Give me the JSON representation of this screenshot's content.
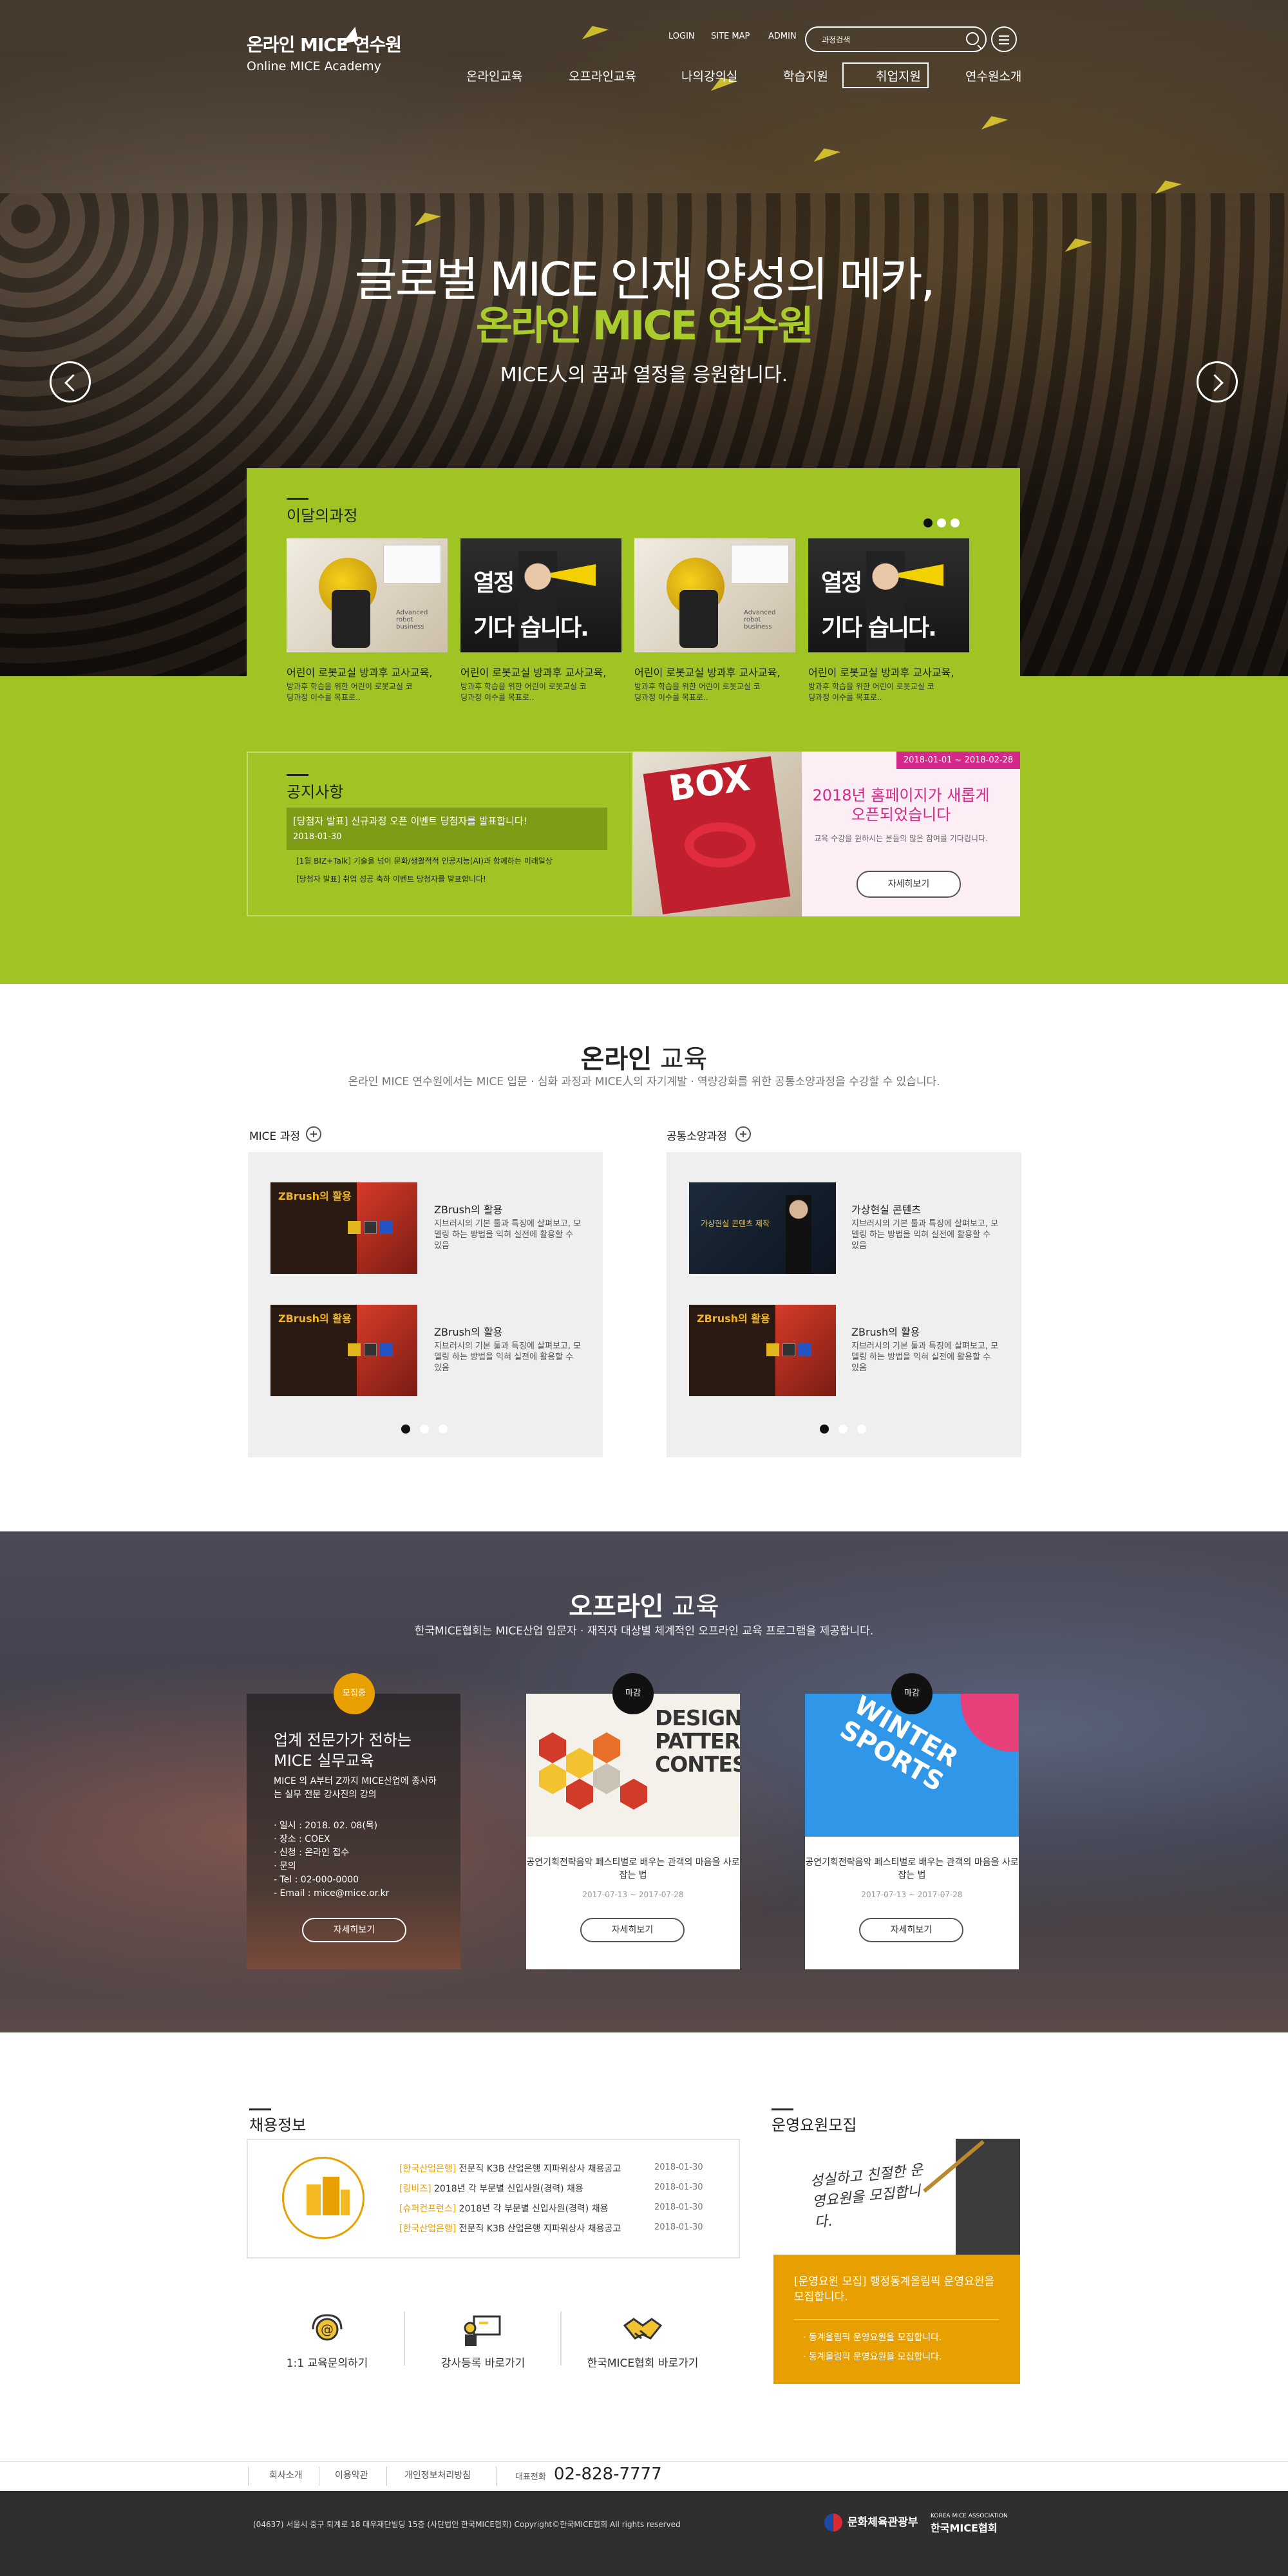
{
  "header": {
    "logo_ko": "온라인 MICE 연수원",
    "logo_en": "Online MICE Academy",
    "util_links": [
      "LOGIN",
      "SITE MAP",
      "ADMIN"
    ],
    "search_label": "과정검색",
    "nav": [
      "온라인교육",
      "오프라인교육",
      "나의강의실",
      "학습지원",
      "취업지원",
      "연수원소개"
    ]
  },
  "hero": {
    "title": "글로벌 MICE 인재 양성의 메카,",
    "subtitle": "온라인 MICE 연수원",
    "desc": "MICE人의 꿈과 열정을 응원합니다."
  },
  "monthly": {
    "title": "이달의과정",
    "cards": [
      {
        "title": "어린이 로봇교실 방과후 교사교육,",
        "desc": "방과후 학습을 위한 어린이 로봇교실 코딩과정 이수를 목표로..",
        "img_text": "Advanced robot business"
      },
      {
        "title": "어린이 로봇교실 방과후 교사교육,",
        "desc": "방과후 학습을 위한 어린이 로봇교실 코딩과정 이수를 목표로..",
        "img_top": "열정",
        "img_bottom": "기다    습니다."
      },
      {
        "title": "어린이 로봇교실 방과후 교사교육,",
        "desc": "방과후 학습을 위한 어린이 로봇교실 코딩과정 이수를 목표로..",
        "img_text": "Advanced robot business"
      },
      {
        "title": "어린이 로봇교실 방과후 교사교육,",
        "desc": "방과후 학습을 위한 어린이 로봇교실 코딩과정 이수를 목표로..",
        "img_top": "열정",
        "img_bottom": "기다    습니다."
      }
    ]
  },
  "notice": {
    "title": "공지사항",
    "highlight_title": "[당첨자 발표] 신규과정 오픈 이벤트 당첨자를 발표합니다!",
    "highlight_date": "2018-01-30",
    "items": [
      "[1월 BIZ+Talk] 기술을 넘어 문화/생활적적 인공지능(AI)과 함께하는 미래일상",
      "[당첨자 발표] 취업 성공 축하 이벤트 당첨자를 발표합니다!"
    ]
  },
  "event": {
    "box_text": "BOX",
    "date": "2018-01-01 ~ 2018-02-28",
    "title": "2018년 홈페이지가 새롭게 오픈되었습니다",
    "desc": "교육 수강을 원하시는 분들의 많은 참여를 기다립니다.",
    "button": "자세히보기"
  },
  "online": {
    "title_bold": "온라인",
    "title_rest": " 교육",
    "desc": "온라인 MICE 연수원에서는 MICE 입문 · 심화 과정과 MICE人의 자기계발 · 역량강화를 위한 공통소양과정을 수강할 수 있습니다.",
    "left_header": "MICE 과정",
    "right_header": "공통소양과정",
    "left_items": [
      {
        "title": "ZBrush의 활용",
        "desc": "지브러시의 기본 툴과 특징에 살펴보고, 모델링 하는 방법을 익혀 실전에 활용할 수 있음",
        "thumb": "ZBrush의 활용"
      },
      {
        "title": "ZBrush의 활용",
        "desc": "지브러시의 기본 툴과 특징에 살펴보고, 모델링 하는 방법을 익혀 실전에 활용할 수 있음",
        "thumb": "ZBrush의 활용"
      }
    ],
    "right_items": [
      {
        "title": "가상현실 콘텐츠",
        "desc": "지브러시의 기본 툴과 특징에 살펴보고, 모델링 하는 방법을 익혀 실전에 활용할 수 있음",
        "thumb": "가상현실 콘텐츠 제작"
      },
      {
        "title": "ZBrush의 활용",
        "desc": "지브러시의 기본 툴과 특징에 살펴보고, 모델링 하는 방법을 익혀 실전에 활용할 수 있음",
        "thumb": "ZBrush의 활용"
      }
    ]
  },
  "offline": {
    "title_bold": "오프라인",
    "title_rest": " 교육",
    "desc": "한국MICE협회는 MICE산업 입문자 · 재직자 대상별 체계적인 오프라인 교육 프로그램을 제공합니다.",
    "card1": {
      "badge": "모집중",
      "title": "업계 전문가가 전하는 MICE 실무교육",
      "intro": "MICE 의 A부터 Z까지 MICE산업에 종사하는 실무 전문 강사진의 강의",
      "details": [
        "· 일시 : 2018. 02. 08(목)",
        "· 장소 : COEX",
        "· 신청 : 온라인 접수",
        "· 문의",
        "  - Tel : 02-000-0000",
        "  - Email : mice@mice.or.kr"
      ],
      "button": "자세히보기"
    },
    "card2": {
      "badge": "마감",
      "img_text": "DESIGN PATTERN CONTEST",
      "desc": "공연기획전략음악 페스티벌로 배우는 관객의 마음을 사로잡는 법",
      "date": "2017-07-13 ~ 2017-07-28",
      "button": "자세히보기"
    },
    "card3": {
      "badge": "마감",
      "img_text": "WINTER SPORTS",
      "desc": "공연기획전략음악 페스티벌로 배우는 관객의 마음을 사로잡는 법",
      "date": "2017-07-13 ~ 2017-07-28",
      "button": "자세히보기"
    }
  },
  "jobs": {
    "title": "채용정보",
    "rows": [
      {
        "cat": "[한국산업은행]",
        "text": " 전문직 K3B 산업은행 지파워상사 채용공고",
        "date": "2018-01-30"
      },
      {
        "cat": "[링비즈]",
        "text": " 2018년 각 부문별 신입사원(경력) 채용",
        "date": "2018-01-30"
      },
      {
        "cat": "[슈퍼컨프런스]",
        "text": " 2018년 각 부문별 신입사원(경력) 채용",
        "date": "2018-01-30"
      },
      {
        "cat": "[한국산업은행]",
        "text": " 전문직 K3B 산업은행 지파워상사 채용공고",
        "date": "2018-01-30"
      }
    ],
    "quick": [
      "1:1 교육문의하기",
      "강사등록 바로가기",
      "한국MICE협회 바로가기"
    ]
  },
  "recruit": {
    "title": "운영요원모집",
    "img_text": "성실하고 친절한 운영요원을 모집합니다.",
    "highlight": "[운영요원 모집] 행정동계올림픽 운영요원을 모집합니다.",
    "items": [
      "· 동계올림픽 운영요원을 모집합니다.",
      "· 동계올림픽 운영요원을 모집합니다."
    ]
  },
  "footer": {
    "links": [
      "회사소개",
      "이용약관",
      "개인정보처리방침"
    ],
    "phone_label": "대표전화",
    "phone": "02-828-7777",
    "address": "(04637) 서울시 중구 퇴계로 18 대우재단빌딩 15층 (사단법인 한국MICE협회) Copyright©한국MICE협회 All rights reserved",
    "ministry": "문화체육관광부",
    "kmice_sub": "KOREA MICE ASSOCIATION",
    "kmice": "한국MICE협회"
  },
  "colors": {
    "green": "#a1c425",
    "pink": "#d6278a",
    "orange": "#e8a000",
    "dark": "#2f2f2f"
  }
}
